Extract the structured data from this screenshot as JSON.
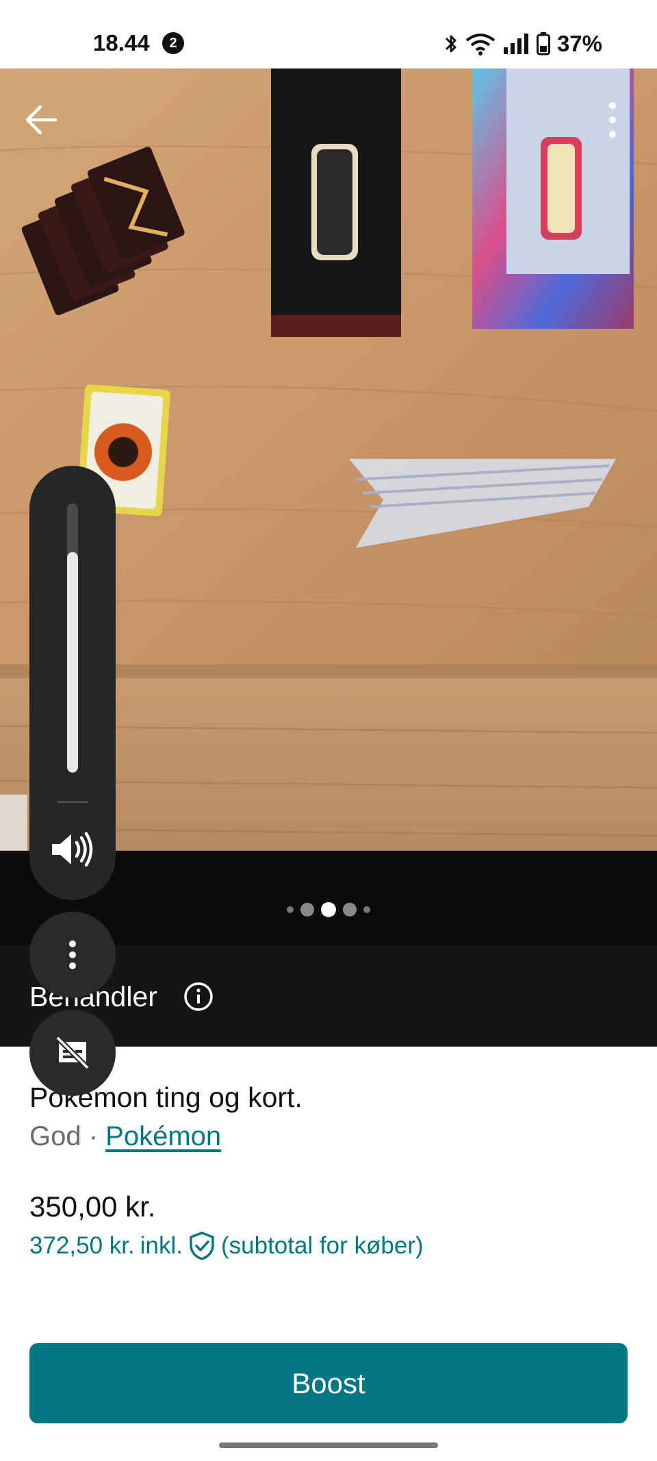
{
  "status_bar": {
    "time": "18.44",
    "notification_count": "2",
    "battery": "37%"
  },
  "gallery": {
    "photo_count": 5,
    "active_index": 2
  },
  "listing": {
    "status": "Behandler",
    "title": "Pokemon ting og kort.",
    "condition": "God",
    "separator": " · ",
    "category": "Pokémon",
    "price": "350,00 kr.",
    "subtotal_price": "372,50 kr.",
    "subtotal_incl": "inkl.",
    "subtotal_note": "(subtotal for køber)"
  },
  "actions": {
    "boost_label": "Boost"
  },
  "volume": {
    "level_percent": 82
  },
  "colors": {
    "accent": "#007782",
    "banner_bg": "#151515",
    "overlay_bg": "#262626"
  },
  "icons": [
    "back-arrow-icon",
    "more-vertical-icon",
    "info-icon",
    "shield-check-icon",
    "volume-icon",
    "more-options-icon",
    "captions-off-icon",
    "bluetooth-icon",
    "wifi-icon",
    "signal-icon",
    "battery-icon"
  ]
}
